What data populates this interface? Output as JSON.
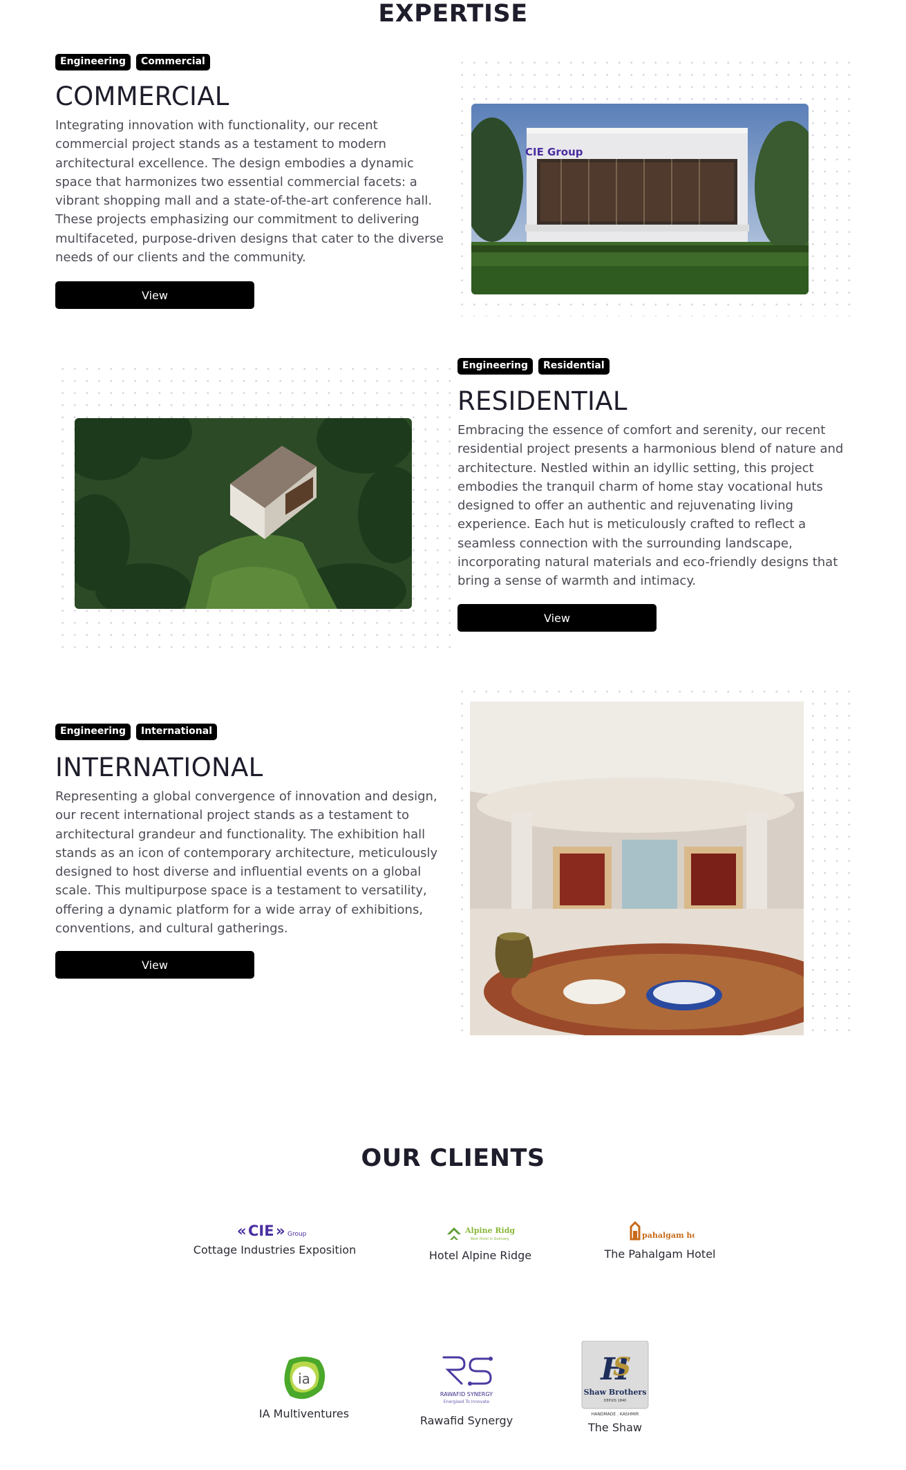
{
  "expertise": {
    "title": "EXPERTISE",
    "projects": [
      {
        "tags": [
          "Engineering",
          "Commercial"
        ],
        "heading": "COMMERCIAL",
        "text": "Integrating innovation with functionality, our recent commercial project stands as a testament to modern architectural excellence. The design embodies a dynamic space that harmonizes two essential commercial facets: a vibrant shopping mall and a state-of-the-art conference hall. These projects emphasizing our commitment to delivering multifaceted, purpose-driven designs that cater to the diverse needs of our clients and the community.",
        "button": "View",
        "image_sign": "CIE Group"
      },
      {
        "tags": [
          "Engineering",
          "Residential"
        ],
        "heading": "RESIDENTIAL",
        "text": "Embracing the essence of comfort and serenity, our recent residential project presents a harmonious blend of nature and architecture. Nestled within an idyllic setting, this project embodies the tranquil charm of home stay vocational huts designed to offer an authentic and rejuvenating living experience. Each hut is meticulously crafted to reflect a seamless connection with the surrounding landscape, incorporating natural materials and eco-friendly designs that bring a sense of warmth and intimacy.",
        "button": "View"
      },
      {
        "tags": [
          "Engineering",
          "International"
        ],
        "heading": "INTERNATIONAL",
        "text": "Representing a global convergence of innovation and design, our recent international project stands as a testament to architectural grandeur and functionality. The exhibition hall stands as an icon of contemporary architecture, meticulously designed to host diverse and influential events on a global scale. This multipurpose space is a testament to versatility, offering a dynamic platform for a wide array of exhibitions, conventions, and cultural gatherings.",
        "button": "View"
      }
    ]
  },
  "clients": {
    "title": "OUR CLIENTS",
    "items": [
      {
        "name": "Cottage Industries Exposition",
        "logo_text": "CIE",
        "logo_sub": "Group"
      },
      {
        "name": "Hotel Alpine Ridge",
        "logo_text": "Alpine Ridge",
        "logo_sub": "Best Hotel in Gulmarg"
      },
      {
        "name": "The Pahalgam Hotel",
        "logo_text": "pahalgam hotel"
      },
      {
        "name": "IA Multiventures",
        "logo_text": "ia"
      },
      {
        "name": "Rawafid Synergy",
        "logo_text": "RAWAFID SYNERGY",
        "logo_sub": "Energised To Innovate"
      },
      {
        "name": "The Shaw",
        "logo_text": "Shaw Brothers",
        "logo_sub": "DEPUIS 1840",
        "logo_foot": "HANDMADE . KASHMIR"
      }
    ]
  },
  "colors": {
    "button_bg": "#000000",
    "heading": "#1d1d2b",
    "body_text": "#4b4b55",
    "cie_purple": "#4a2ea0",
    "alpine_green": "#5a9a2e",
    "pahalgam_orange": "#c86a1a",
    "ia_green": "#4aa82a"
  }
}
